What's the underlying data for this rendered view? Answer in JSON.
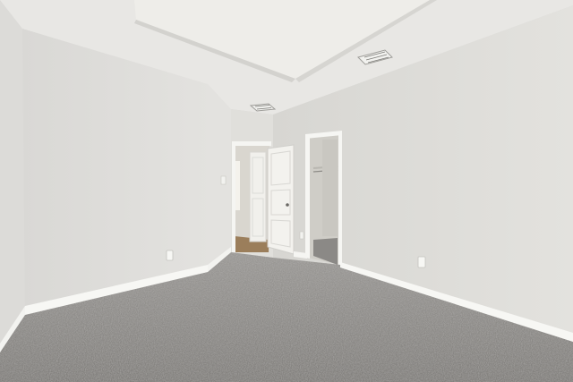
{
  "image": {
    "subject": "empty-bedroom-interior",
    "colors": {
      "ceiling": "#e9e8e5",
      "ceiling_recess": "#eeede9",
      "wall_left": "#e2e1de",
      "wall_back": "#dddcd8",
      "wall_right": "#e0dfdb",
      "baseboard": "#f7f7f4",
      "carpet": "#8d8b88",
      "door": "#f3f2ee",
      "closet_interior": "#cfcdc7",
      "hallway_floor": "#9b7e5b"
    }
  }
}
